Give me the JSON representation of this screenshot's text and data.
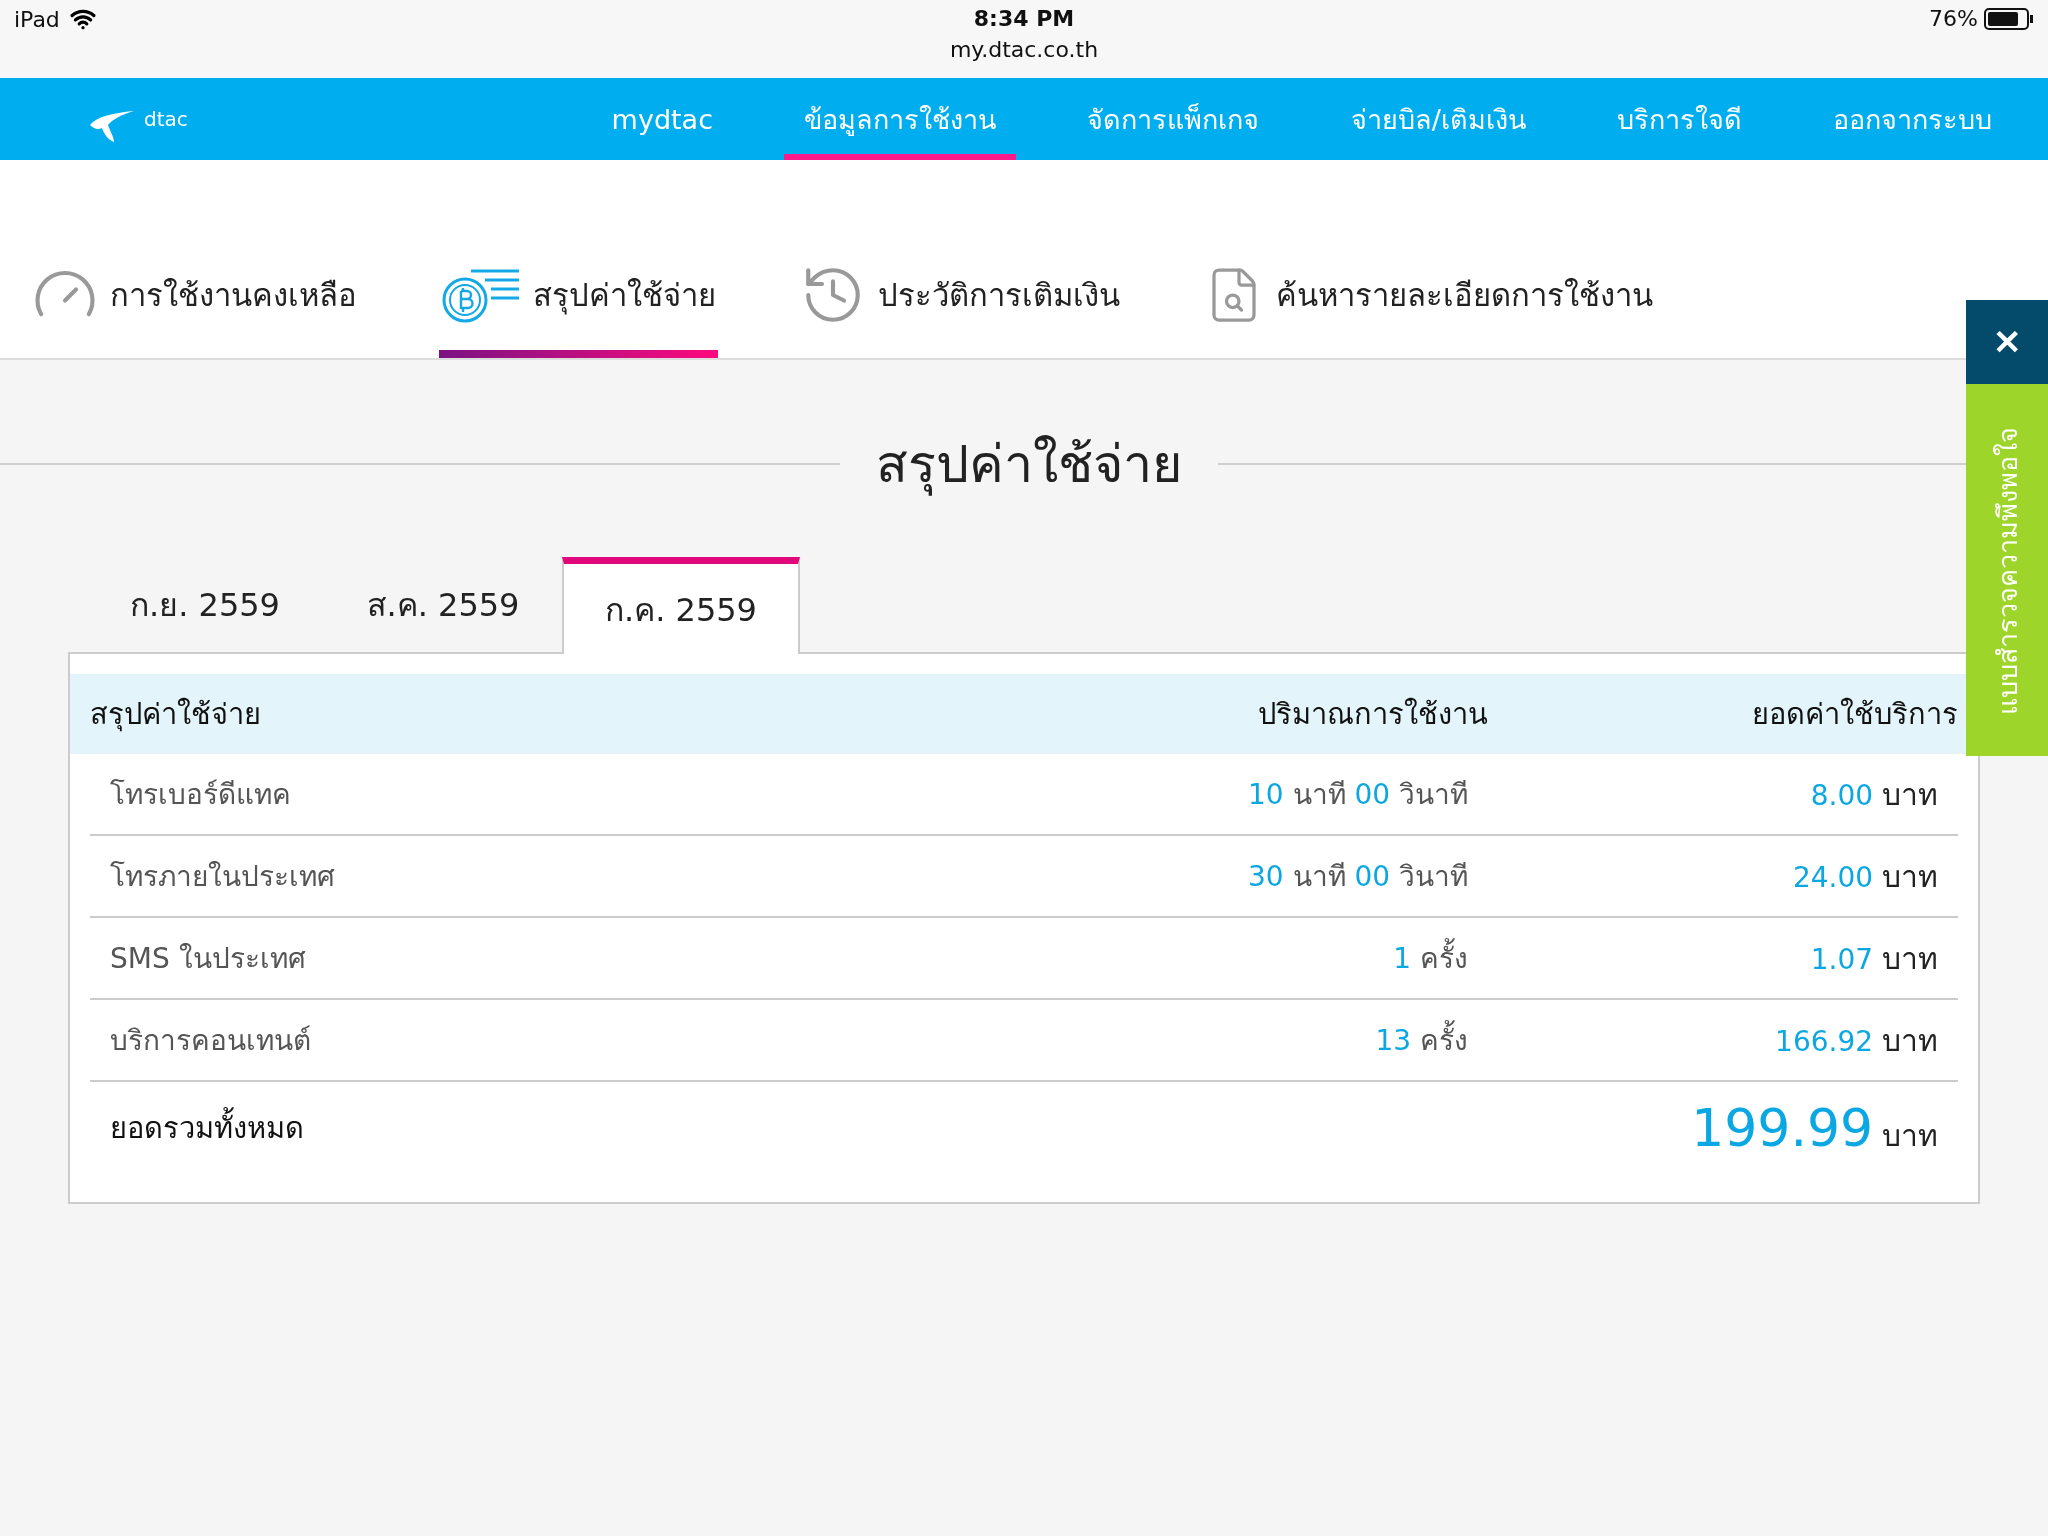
{
  "status_bar": {
    "device": "iPad",
    "time": "8:34 PM",
    "url": "my.dtac.co.th",
    "battery": "76%"
  },
  "nav": {
    "logo": "dtac",
    "items": [
      {
        "label": "mydtac",
        "selected": false
      },
      {
        "label": "ข้อมูลการใช้งาน",
        "selected": true
      },
      {
        "label": "จัดการแพ็กเกจ",
        "selected": false
      },
      {
        "label": "จ่ายบิล/เติมเงิน",
        "selected": false
      },
      {
        "label": "บริการใจดี",
        "selected": false
      },
      {
        "label": "ออกจากระบบ",
        "selected": false
      }
    ]
  },
  "section_tabs": [
    {
      "kind": "gauge",
      "label": "การใช้งานคงเหลือ",
      "selected": false
    },
    {
      "kind": "coin",
      "label": "สรุปค่าใช้จ่าย",
      "selected": true
    },
    {
      "kind": "history",
      "label": "ประวัติการเติมเงิน",
      "selected": false
    },
    {
      "kind": "search",
      "label": "ค้นหารายละเอียดการใช้งาน",
      "selected": false
    }
  ],
  "heading": "สรุปค่าใช้จ่าย",
  "month_tabs": [
    {
      "label": "ก.ย. 2559",
      "selected": false
    },
    {
      "label": "ส.ค. 2559",
      "selected": false
    },
    {
      "label": "ก.ค. 2559",
      "selected": true
    }
  ],
  "table": {
    "columns": [
      "สรุปค่าใช้จ่าย",
      "ปริมาณการใช้งาน",
      "ยอดค่าใช้บริการ"
    ],
    "rows": [
      {
        "item": "โทรเบอร์ดีแทค",
        "usage": [
          {
            "value": "10",
            "unit": "นาที"
          },
          {
            "value": "00",
            "unit": "วินาที"
          }
        ],
        "charge": {
          "value": "8.00",
          "unit": "บาท"
        }
      },
      {
        "item": "โทรภายในประเทศ",
        "usage": [
          {
            "value": "30",
            "unit": "นาที"
          },
          {
            "value": "00",
            "unit": "วินาที"
          }
        ],
        "charge": {
          "value": "24.00",
          "unit": "บาท"
        }
      },
      {
        "item": "SMS ในประเทศ",
        "usage": [
          {
            "value": "1",
            "unit": "ครั้ง"
          }
        ],
        "charge": {
          "value": "1.07",
          "unit": "บาท"
        }
      },
      {
        "item": "บริการคอนเทนต์",
        "usage": [
          {
            "value": "13",
            "unit": "ครั้ง"
          }
        ],
        "charge": {
          "value": "166.92",
          "unit": "บาท"
        }
      }
    ],
    "total": {
      "label": "ยอดรวมทั้งหมด",
      "value": "199.99",
      "unit": "บาท"
    }
  },
  "feedback": {
    "close": "✕",
    "label": "แบบสำรวจความพึงพอใจ"
  }
}
